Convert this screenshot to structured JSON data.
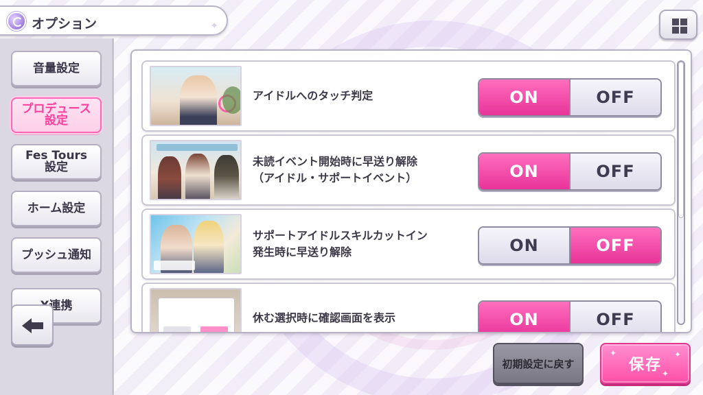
{
  "header": {
    "title": "オプション"
  },
  "sidebar": {
    "items": [
      {
        "label": "音量設定",
        "active": false
      },
      {
        "label": "プロデュース\n設定",
        "active": true
      },
      {
        "label": "Fes Tours\n設定",
        "active": false
      },
      {
        "label": "ホーム設定",
        "active": false
      },
      {
        "label": "プッシュ通知",
        "active": false
      },
      {
        "label": "X連携",
        "active": false
      }
    ]
  },
  "settings": [
    {
      "label": "アイドルへのタッチ判定",
      "on": "ON",
      "off": "OFF",
      "selected": "on"
    },
    {
      "label": "未読イベント開始時に早送り解除\n（アイドル・サポートイベント）",
      "on": "ON",
      "off": "OFF",
      "selected": "on"
    },
    {
      "label": "サポートアイドルスキルカットイン\n発生時に早送り解除",
      "on": "ON",
      "off": "OFF",
      "selected": "off"
    },
    {
      "label": "休む選択時に確認画面を表示",
      "on": "ON",
      "off": "OFF",
      "selected": "on"
    }
  ],
  "footer": {
    "reset_label": "初期設定に戻す",
    "save_label": "保存"
  },
  "colors": {
    "accent_pink": "#ff4fa7",
    "toggle_on": "#e8339a",
    "sidebar_bg": "#dbd8e3"
  },
  "icons": [
    "menu-grid-icon",
    "back-arrow-icon",
    "options-icon"
  ]
}
